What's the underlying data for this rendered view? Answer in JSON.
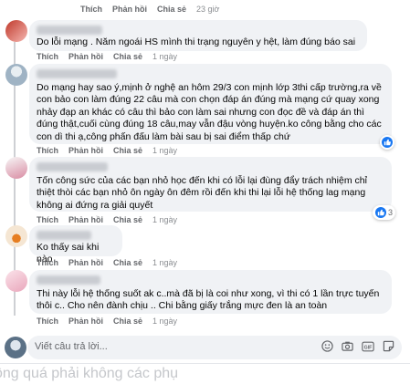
{
  "actions": {
    "like": "Thích",
    "reply": "Phản hồi",
    "share": "Chia sẻ"
  },
  "top_actions": {
    "time": "23 giờ"
  },
  "comments": [
    {
      "text": "Do lỗi mạng . Năm ngoái HS mình thi trạng nguyên y hệt, làm đúng báo sai",
      "time": "1 ngày"
    },
    {
      "text": "Do mạng hay sao ý,mịnh ở nghệ an hôm 29/3 con mịnh lớp 3thi cấp trường,ra về con bảo con làm đúng 22 câu mà con chọn đáp án đúng mà mạng cứ quay xong nhảy đạp an khác có câu thì bảo con làm sai nhưng con đọc đề và đáp án thì đúng thật,cuối cùng đúng 18 câu,may vẫn đậu vòng huyện.ko công bằng cho các con dì thi ạ,công phấn đấu làm bài sau bị sai điểm thấp chứ",
      "time": "1 ngày",
      "reaction": ""
    },
    {
      "text": "Tốn công sức của các bạn nhỏ học đến khi có lỗi lại đùng đẩy trách nhiệm chỉ thiệt thòi các bạn nhỏ ôn ngày ôn đêm rồi đến khi thi lại lỗi hệ thống lag mạng không ai đứng ra giải quyết",
      "time": "1 ngày",
      "reaction": "3"
    },
    {
      "text": "Ko thấy sai khi nào",
      "time": "1 ngày"
    },
    {
      "text": "Thi này lỗi hệ thống suốt ak c..mà đã bị là coi như xong, vì thi có 1 lần trực tuyến thôi c.. Cho nên đành chịu .. Chi bằng giấy trắng mực đen là an toàn",
      "time": "1 ngày"
    }
  ],
  "reply_box": {
    "placeholder": "Viết câu trả lời..."
  },
  "background_text": "ông quá phải không các phụ",
  "colors": {
    "bubble": "#f0f2f5",
    "like": "#1877f2",
    "meta": "#65676b"
  },
  "icons": [
    "like-icon",
    "emoji-icon",
    "camera-icon",
    "gif-icon",
    "sticker-icon"
  ]
}
